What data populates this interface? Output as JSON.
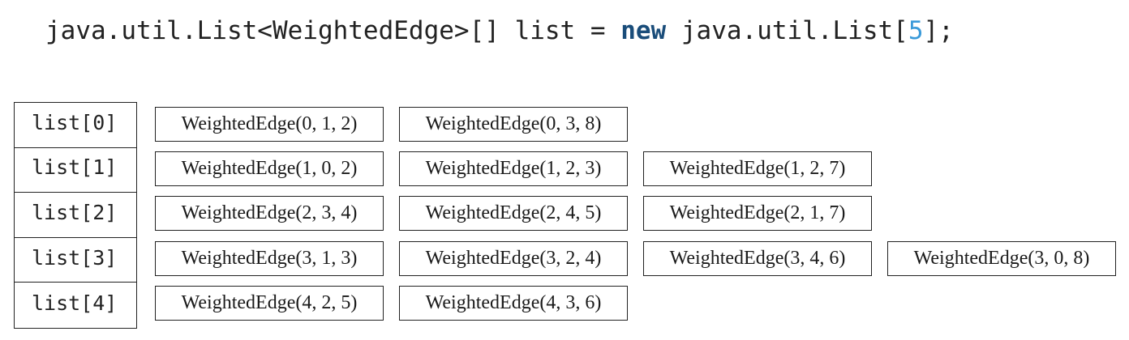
{
  "code": {
    "prefix": "java.util.List<WeightedEdge>[] list = ",
    "keyword": "new",
    "middle": " java.util.List[",
    "number": "5",
    "suffix": "];"
  },
  "rows": [
    {
      "index_label": "list[0]",
      "edges": [
        "WeightedEdge(0, 1, 2)",
        "WeightedEdge(0, 3, 8)"
      ]
    },
    {
      "index_label": "list[1]",
      "edges": [
        "WeightedEdge(1, 0, 2)",
        "WeightedEdge(1, 2, 3)",
        "WeightedEdge(1, 2, 7)"
      ]
    },
    {
      "index_label": "list[2]",
      "edges": [
        "WeightedEdge(2, 3, 4)",
        "WeightedEdge(2, 4, 5)",
        "WeightedEdge(2, 1, 7)"
      ]
    },
    {
      "index_label": "list[3]",
      "edges": [
        "WeightedEdge(3, 1, 3)",
        "WeightedEdge(3, 2, 4)",
        "WeightedEdge(3, 4, 6)",
        "WeightedEdge(3, 0, 8)"
      ]
    },
    {
      "index_label": "list[4]",
      "edges": [
        "WeightedEdge(4, 2, 5)",
        "WeightedEdge(4, 3, 6)"
      ]
    }
  ],
  "colors": {
    "keyword": "#1a4d7a",
    "number": "#3a9ad9",
    "border": "#222222"
  }
}
